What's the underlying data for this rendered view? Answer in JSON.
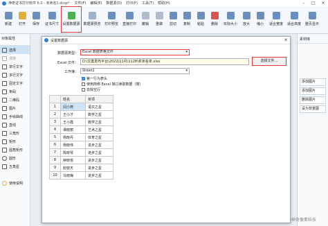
{
  "window": {
    "title": "神奇证书打印软件 6.0 - 未命名1.dcsp*",
    "menu": [
      "文件(F)",
      "编辑(E)",
      "数据源(D)",
      "打印(P)",
      "工具(T)",
      "帮助(H)"
    ],
    "controls": [
      "–",
      "□",
      "✕"
    ]
  },
  "toolbar": {
    "buttons": [
      "新建",
      "打开",
      "保存",
      "证书尺寸",
      "设置数据源",
      "数据源预览",
      "打印预览",
      "直接打印",
      "撤销",
      "重做",
      "剪切",
      "复制",
      "粘贴",
      "删除",
      "实际大小",
      "放大",
      "缩小",
      "适合宽度",
      "适合高度",
      "整页显示"
    ]
  },
  "left_panel": {
    "header": "对象属性",
    "items": [
      "选择",
      "漫游",
      "单行文字",
      "多行文字",
      "固定文字",
      "条码",
      "二维码",
      "图片",
      "手绘曲线",
      "直线",
      "三角形",
      "矩形",
      "圆角矩形",
      "圆形",
      "五角星",
      "使用说明"
    ]
  },
  "right_panel": {
    "header": "素材库",
    "rows": [
      "添加图片",
      "添加图片",
      "删除图片",
      "设为背景图"
    ]
  },
  "dialog": {
    "title": "设置数据源",
    "close": "✕",
    "data_type_label": "数据源类型：",
    "data_type_value": "Excel 数据表格文件",
    "excel_file_label": "Excel 文件：",
    "excel_file_value": "D:\\文案发布平台\\2022\\11月\\1128\\奖状名单.xlsx",
    "choose_button": "选择文件…",
    "worksheet_label": "工作簿：",
    "worksheet_value": "Sheet1",
    "checkboxes": [
      {
        "label": "第一行为表头",
        "checked": true
      },
      {
        "label": "使用简称 Excel 接口读取数据（慢）",
        "checked": false
      },
      {
        "label": "去除空行",
        "checked": false
      }
    ],
    "table": {
      "headers": [
        "",
        "姓名",
        "奖项"
      ],
      "rows": [
        [
          "1",
          "闫小燕",
          "语文之星"
        ],
        [
          "2",
          "王小才",
          "数学之星"
        ],
        [
          "3",
          "王小霞",
          "数学之星"
        ],
        [
          "4",
          "谭晓丽",
          "艺术之星"
        ],
        [
          "5",
          "杨晓丹",
          "体育之星"
        ],
        [
          "6",
          "杨晓伟",
          "进步之星"
        ],
        [
          "7",
          "陈晓琴",
          "进步之星"
        ],
        [
          "8",
          "钟晓悦",
          "进步之星"
        ],
        [
          "9",
          "赵晓天",
          "进步之星"
        ],
        [
          "10",
          "马晓梅",
          "进步之星"
        ]
      ]
    }
  },
  "watermark": "CSDN @神奇像素科技",
  "colors": {
    "accent": "#2f7fd7",
    "highlight": "#e23a3a",
    "file_field": "#fffde8"
  }
}
